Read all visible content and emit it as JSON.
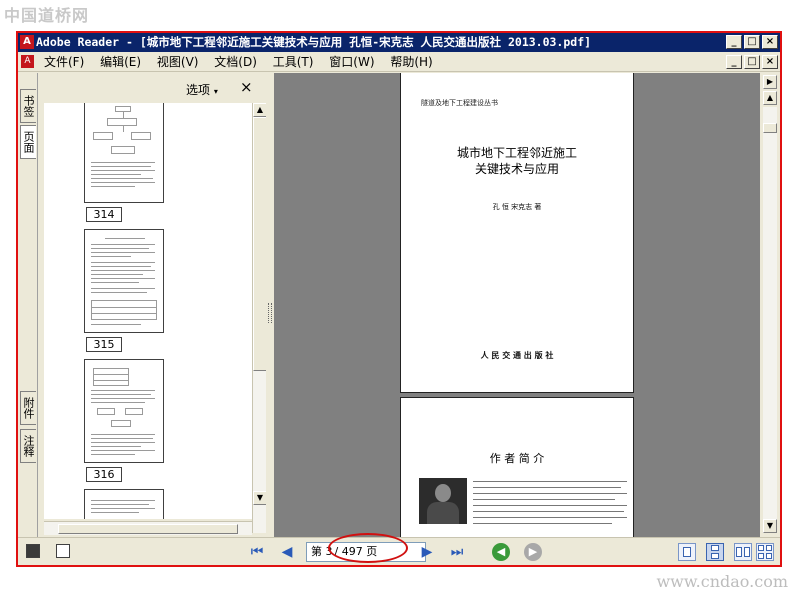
{
  "watermarks": {
    "top": "中国道桥网",
    "bottom": "www.cndao.com"
  },
  "window": {
    "title": "Adobe Reader - [城市地下工程邻近施工关键技术与应用 孔恒-宋克志 人民交通出版社 2013.03.pdf]",
    "icon": "adobe-reader-icon",
    "controls": {
      "minimize": "_",
      "maximize": "□",
      "close": "×"
    }
  },
  "menubar": {
    "items": [
      "文件(F)",
      "编辑(E)",
      "视图(V)",
      "文档(D)",
      "工具(T)",
      "窗口(W)",
      "帮助(H)"
    ]
  },
  "left_tabs": {
    "bookmarks": "书签",
    "pages": "页面",
    "attachments": "附件",
    "comments": "注释"
  },
  "nav_panel": {
    "options_label": "选项",
    "close_label": "×",
    "thumbnails": [
      {
        "label": "314"
      },
      {
        "label": "315"
      },
      {
        "label": "316"
      }
    ]
  },
  "document": {
    "page1": {
      "series": "隧道及地下工程建设丛书",
      "title_line1": "城市地下工程邻近施工",
      "title_line2": "关键技术与应用",
      "authors": "孔 恒 宋克志 著",
      "publisher": "人 民 交 通 出 版 社"
    },
    "page2": {
      "heading": "作 者 简 介"
    }
  },
  "statusbar": {
    "page_current": "第 3",
    "page_total": "/ 497 页"
  },
  "colors": {
    "accent_red": "#e01010",
    "titlebar": "#0a246a",
    "nav_blue": "#2a5ab8"
  }
}
